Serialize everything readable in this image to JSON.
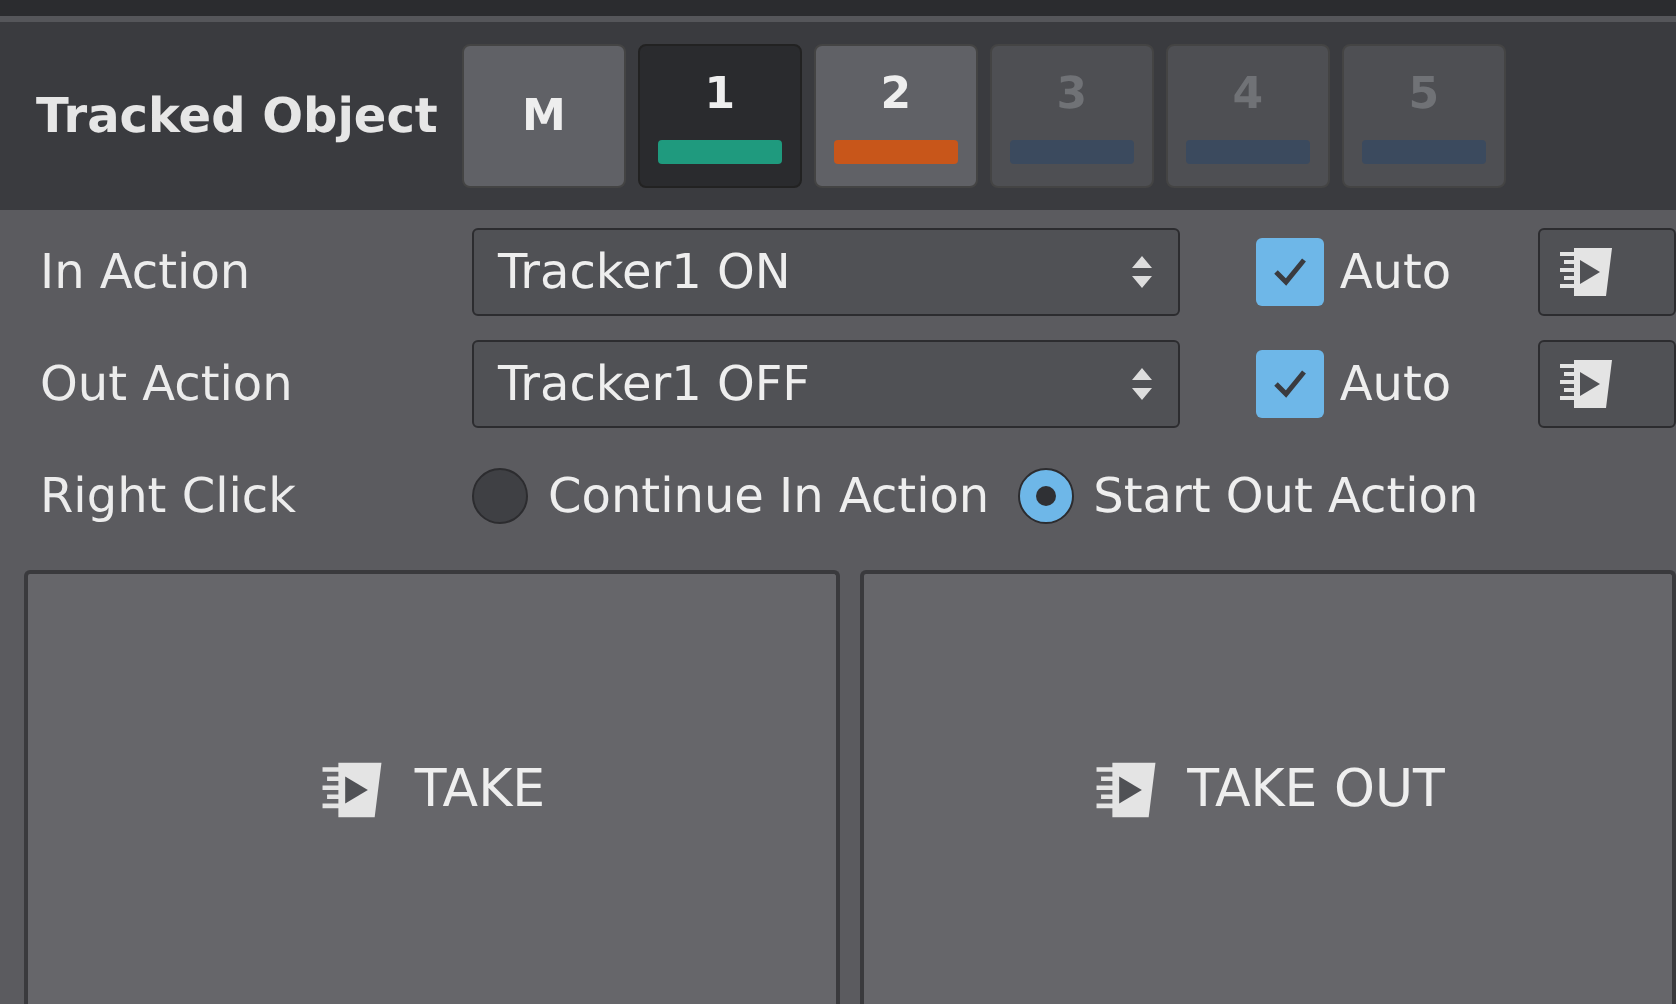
{
  "header": {
    "title": "Tracked Object",
    "objects": [
      {
        "label": "M",
        "selected": false,
        "disabled": false
      },
      {
        "label": "1",
        "selected": true,
        "disabled": false,
        "color": "#1f9a7e"
      },
      {
        "label": "2",
        "selected": false,
        "disabled": false,
        "color": "#c8561a"
      },
      {
        "label": "3",
        "selected": false,
        "disabled": true,
        "color": "#3b4a5e"
      },
      {
        "label": "4",
        "selected": false,
        "disabled": true,
        "color": "#3b4a5e"
      },
      {
        "label": "5",
        "selected": false,
        "disabled": true,
        "color": "#3b4a5e"
      }
    ]
  },
  "actions": [
    {
      "label": "In Action",
      "value": "Tracker1 ON",
      "auto_label": "Auto",
      "auto_checked": true
    },
    {
      "label": "Out Action",
      "value": "Tracker1 OFF",
      "auto_label": "Auto",
      "auto_checked": true
    }
  ],
  "right_click": {
    "label": "Right Click",
    "options": [
      {
        "label": "Continue In Action",
        "selected": false
      },
      {
        "label": "Start Out Action",
        "selected": true
      }
    ]
  },
  "take_buttons": [
    "TAKE",
    "TAKE OUT"
  ]
}
